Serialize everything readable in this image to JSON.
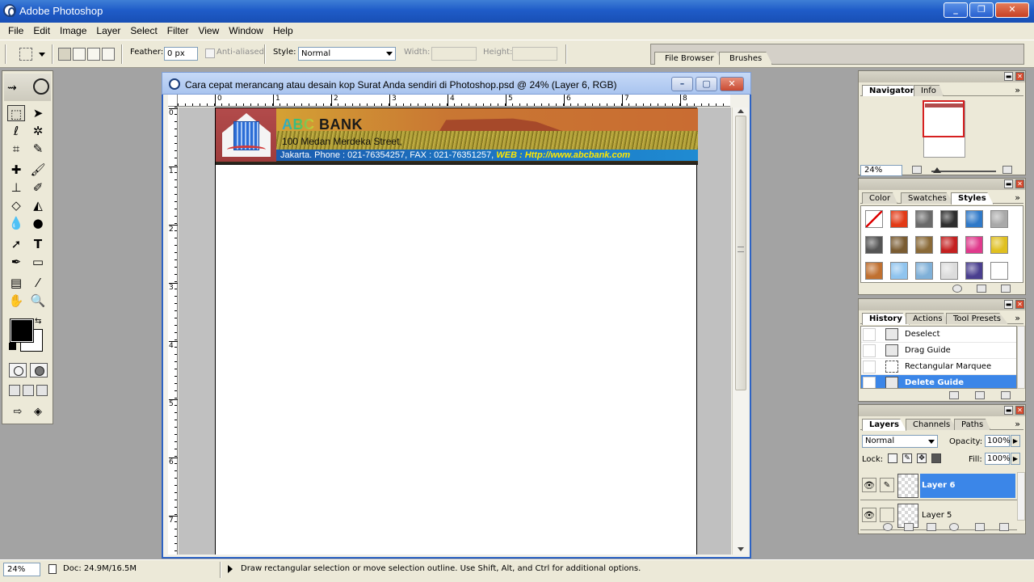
{
  "app": {
    "title": "Adobe Photoshop"
  },
  "menu": [
    "File",
    "Edit",
    "Image",
    "Layer",
    "Select",
    "Filter",
    "View",
    "Window",
    "Help"
  ],
  "options": {
    "feather_label": "Feather:",
    "feather_value": "0 px",
    "antialiased_label": "Anti-aliased",
    "style_label": "Style:",
    "style_value": "Normal",
    "width_label": "Width:",
    "height_label": "Height:",
    "well_tabs": [
      "File Browser",
      "Brushes"
    ]
  },
  "document": {
    "title": "Cara cepat merancang atau desain kop Surat Anda sendiri di Photoshop.psd @ 24% (Layer 6, RGB)",
    "ruler_h": [
      "0",
      "1",
      "2",
      "3",
      "4",
      "5",
      "6",
      "7",
      "8"
    ],
    "ruler_v": [
      "0",
      "1",
      "2",
      "3",
      "4",
      "5",
      "6",
      "7"
    ],
    "banner": {
      "abc": "ABC",
      "bank": "BANK",
      "address": "100 Medan Merdeka Street,",
      "contact": "Jakarta. Phone : 021-76354257, FAX : 021-76351257,",
      "web": "WEB : Http://www.abcbank.com"
    }
  },
  "navigator": {
    "tabs": [
      "Navigator",
      "Info"
    ],
    "zoom": "24%"
  },
  "styles_palette": {
    "tabs": [
      "Color",
      "Swatches",
      "Styles"
    ],
    "swatch_colors": [
      "#ffffff",
      "#e23a16",
      "#6a6a6a",
      "#2e2e2e",
      "#2f79c8",
      "#a9a9a9",
      "#555555",
      "#7a5c32",
      "#8a6a38",
      "#c42020",
      "#e03a8c",
      "#e0c020",
      "#c07030",
      "#8fc4ef",
      "#7fb0d8",
      "#dcdcdc",
      "#4a3f8f",
      "#ffffff"
    ]
  },
  "history": {
    "tabs": [
      "History",
      "Actions",
      "Tool Presets"
    ],
    "items": [
      "Deselect",
      "Drag Guide",
      "Rectangular Marquee",
      "Delete Guide"
    ]
  },
  "layers": {
    "tabs": [
      "Layers",
      "Channels",
      "Paths"
    ],
    "blend_mode": "Normal",
    "opacity_label": "Opacity:",
    "opacity_value": "100%",
    "lock_label": "Lock:",
    "fill_label": "Fill:",
    "fill_value": "100%",
    "items": [
      "Layer 6",
      "Layer 5"
    ]
  },
  "status": {
    "zoom": "24%",
    "doc": "Doc: 24.9M/16.5M",
    "message": "Draw rectangular selection or move selection outline.  Use Shift, Alt, and Ctrl for additional options."
  },
  "colors": {
    "accent": "#3b86e8",
    "titlebar": "#1f5cc8",
    "workspace": "#a3a3a3"
  }
}
